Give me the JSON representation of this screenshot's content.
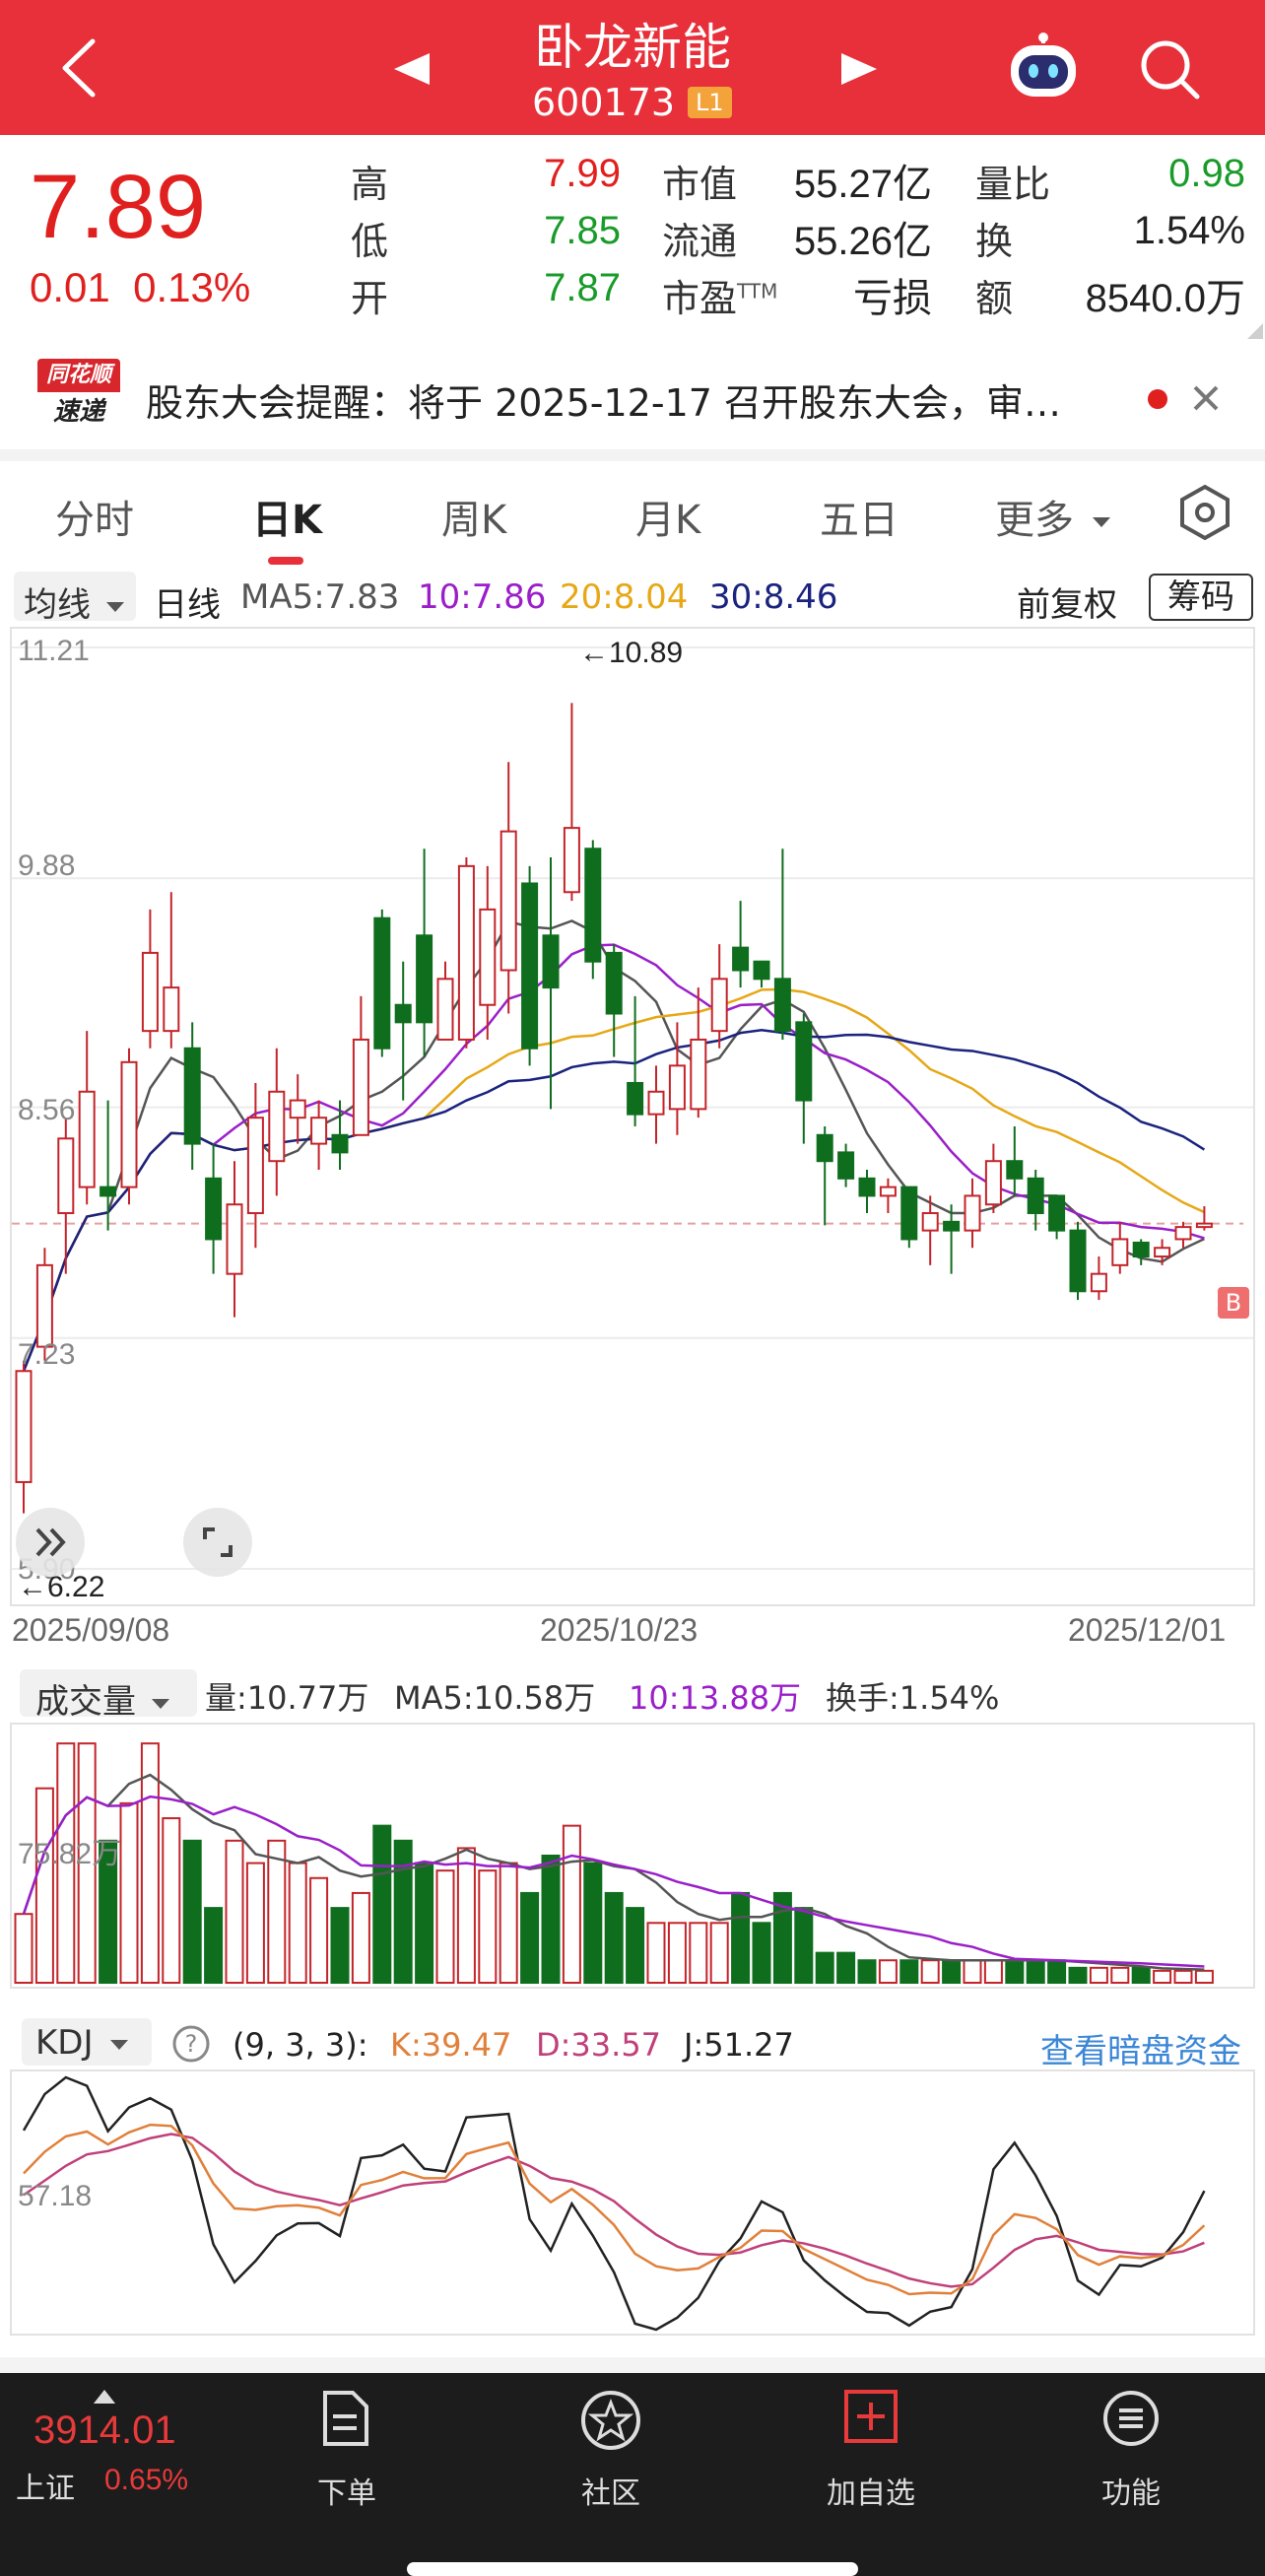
{
  "header": {
    "title": "卧龙新能",
    "code": "600173",
    "level_badge": "L1",
    "icons": [
      "back-icon",
      "prev-stock-icon",
      "next-stock-icon",
      "robot-assistant-icon",
      "search-icon"
    ]
  },
  "quote": {
    "price": "7.89",
    "change": "0.01",
    "change_pct": "0.13%",
    "fields": [
      {
        "label": "高",
        "value": "7.99",
        "color": "#e0201f"
      },
      {
        "label": "低",
        "value": "7.85",
        "color": "#199b2a"
      },
      {
        "label": "开",
        "value": "7.87",
        "color": "#199b2a"
      },
      {
        "label": "市值",
        "value": "55.27亿",
        "color": "#222222"
      },
      {
        "label": "流通",
        "value": "55.26亿",
        "color": "#222222"
      },
      {
        "label": "市盈",
        "label_sup": "TTM",
        "value": "亏损",
        "color": "#222222"
      },
      {
        "label": "量比",
        "value": "0.98",
        "color": "#199b2a"
      },
      {
        "label": "换",
        "value": "1.54%",
        "color": "#222222"
      },
      {
        "label": "额",
        "value": "8540.0万",
        "color": "#222222"
      }
    ]
  },
  "notice": {
    "logo_top": "同花顺",
    "logo_bottom": "速递",
    "text": "股东大会提醒：将于 2025-12-17 召开股东大会，审…"
  },
  "tabs": [
    {
      "label": "分时",
      "active": false
    },
    {
      "label": "日K",
      "active": true
    },
    {
      "label": "周K",
      "active": false
    },
    {
      "label": "月K",
      "active": false
    },
    {
      "label": "五日",
      "active": false
    },
    {
      "label": "更多",
      "active": false
    }
  ],
  "kline_panel": {
    "indicator_select": "均线",
    "period": "日线",
    "ma_legend": [
      {
        "text": "MA5:7.83",
        "color": "#555555"
      },
      {
        "text": "10:7.86",
        "color": "#9a1fc9"
      },
      {
        "text": "20:8.04",
        "color": "#e6a817"
      },
      {
        "text": "30:8.46",
        "color": "#1a237e"
      }
    ],
    "adjust": "前复权",
    "chips_button": "筹码",
    "y_labels": [
      "11.21",
      "9.88",
      "8.56",
      "7.23",
      "5.90"
    ],
    "high_marker": "←10.89",
    "low_marker": "←6.22",
    "dates": [
      "2025/09/08",
      "2025/10/23",
      "2025/12/01"
    ],
    "buy_marker": "B",
    "colors": {
      "up": "#c3242a",
      "down": "#0f6e1e",
      "ma5": "#555555",
      "ma10": "#9a1fc9",
      "ma20": "#e6a817",
      "ma30": "#1a237e"
    }
  },
  "volume_panel": {
    "select": "成交量",
    "vol": "量:10.77万",
    "ma5": "MA5:10.58万",
    "ma10": "10:13.88万",
    "turnover": "换手:1.54%",
    "y_label": "75.82万"
  },
  "kdj_panel": {
    "select": "KDJ",
    "params": "(9, 3, 3):",
    "k": "K:39.47",
    "d": "D:33.57",
    "j": "J:51.27",
    "link": "查看暗盘资金",
    "y_label": "57.18",
    "colors": {
      "k": "#e0803a",
      "d": "#c0407a",
      "j": "#222222"
    }
  },
  "bottom_bar": {
    "index_value": "3914.01",
    "index_name": "上证",
    "index_pct": "0.65%",
    "items": [
      {
        "label": "下单",
        "icon": "order-document-icon"
      },
      {
        "label": "社区",
        "icon": "community-star-icon"
      },
      {
        "label": "加自选",
        "icon": "add-watchlist-icon"
      },
      {
        "label": "功能",
        "icon": "menu-function-icon"
      }
    ]
  },
  "chart_data": {
    "type": "candlestick",
    "dates_shown": [
      "2025/09/08",
      "2025/10/23",
      "2025/12/01"
    ],
    "ylim": [
      5.9,
      11.21
    ],
    "y_ticks": [
      11.21,
      9.88,
      8.56,
      7.23,
      5.9
    ],
    "candles": [
      {
        "o": 6.4,
        "c": 7.04,
        "h": 7.1,
        "l": 6.22
      },
      {
        "o": 7.18,
        "c": 7.65,
        "h": 7.75,
        "l": 7.1
      },
      {
        "o": 7.95,
        "c": 8.38,
        "h": 8.5,
        "l": 7.6
      },
      {
        "o": 8.1,
        "c": 8.65,
        "h": 9.0,
        "l": 8.0
      },
      {
        "o": 8.1,
        "c": 8.05,
        "h": 8.6,
        "l": 7.85
      },
      {
        "o": 8.1,
        "c": 8.82,
        "h": 8.9,
        "l": 8.0
      },
      {
        "o": 9.0,
        "c": 9.45,
        "h": 9.7,
        "l": 8.9
      },
      {
        "o": 9.0,
        "c": 9.25,
        "h": 9.8,
        "l": 8.9
      },
      {
        "o": 8.9,
        "c": 8.35,
        "h": 9.05,
        "l": 8.2
      },
      {
        "o": 8.15,
        "c": 7.8,
        "h": 8.35,
        "l": 7.6
      },
      {
        "o": 7.6,
        "c": 8.0,
        "h": 8.25,
        "l": 7.35
      },
      {
        "o": 7.95,
        "c": 8.5,
        "h": 8.7,
        "l": 7.75
      },
      {
        "o": 8.25,
        "c": 8.65,
        "h": 8.9,
        "l": 8.05
      },
      {
        "o": 8.5,
        "c": 8.6,
        "h": 8.75,
        "l": 8.35
      },
      {
        "o": 8.35,
        "c": 8.5,
        "h": 8.6,
        "l": 8.2
      },
      {
        "o": 8.4,
        "c": 8.3,
        "h": 8.6,
        "l": 8.2
      },
      {
        "o": 8.4,
        "c": 8.95,
        "h": 9.2,
        "l": 8.4
      },
      {
        "o": 9.65,
        "c": 8.9,
        "h": 9.7,
        "l": 8.85
      },
      {
        "o": 9.15,
        "c": 9.05,
        "h": 9.4,
        "l": 8.6
      },
      {
        "o": 9.55,
        "c": 9.05,
        "h": 10.05,
        "l": 8.85
      },
      {
        "o": 8.95,
        "c": 9.3,
        "h": 9.4,
        "l": 8.95
      },
      {
        "o": 8.95,
        "c": 9.95,
        "h": 10.0,
        "l": 8.9
      },
      {
        "o": 9.15,
        "c": 9.7,
        "h": 9.95,
        "l": 8.95
      },
      {
        "o": 9.35,
        "c": 10.15,
        "h": 10.55,
        "l": 9.1
      },
      {
        "o": 9.85,
        "c": 8.9,
        "h": 9.95,
        "l": 8.8
      },
      {
        "o": 9.55,
        "c": 9.25,
        "h": 10.0,
        "l": 8.55
      },
      {
        "o": 9.8,
        "c": 10.17,
        "h": 10.89,
        "l": 9.75
      },
      {
        "o": 10.05,
        "c": 9.4,
        "h": 10.1,
        "l": 9.3
      },
      {
        "o": 9.45,
        "c": 9.1,
        "h": 9.5,
        "l": 8.85
      },
      {
        "o": 8.7,
        "c": 8.52,
        "h": 9.2,
        "l": 8.45
      },
      {
        "o": 8.52,
        "c": 8.65,
        "h": 8.8,
        "l": 8.35
      },
      {
        "o": 8.55,
        "c": 8.8,
        "h": 9.05,
        "l": 8.4
      },
      {
        "o": 8.55,
        "c": 8.95,
        "h": 9.25,
        "l": 8.5
      },
      {
        "o": 9.0,
        "c": 9.3,
        "h": 9.5,
        "l": 8.9
      },
      {
        "o": 9.48,
        "c": 9.35,
        "h": 9.75,
        "l": 9.25
      },
      {
        "o": 9.4,
        "c": 9.3,
        "h": 9.4,
        "l": 9.25
      },
      {
        "o": 9.3,
        "c": 9.0,
        "h": 10.05,
        "l": 8.95
      },
      {
        "o": 9.05,
        "c": 8.6,
        "h": 9.1,
        "l": 8.35
      },
      {
        "o": 8.4,
        "c": 8.25,
        "h": 8.45,
        "l": 7.88
      },
      {
        "o": 8.3,
        "c": 8.15,
        "h": 8.35,
        "l": 8.1
      },
      {
        "o": 8.15,
        "c": 8.05,
        "h": 8.2,
        "l": 7.95
      },
      {
        "o": 8.05,
        "c": 8.1,
        "h": 8.15,
        "l": 7.95
      },
      {
        "o": 8.1,
        "c": 7.8,
        "h": 8.1,
        "l": 7.75
      },
      {
        "o": 7.85,
        "c": 7.95,
        "h": 8.05,
        "l": 7.65
      },
      {
        "o": 7.9,
        "c": 7.85,
        "h": 8.0,
        "l": 7.6
      },
      {
        "o": 7.85,
        "c": 8.05,
        "h": 8.15,
        "l": 7.75
      },
      {
        "o": 8.0,
        "c": 8.25,
        "h": 8.35,
        "l": 7.95
      },
      {
        "o": 8.25,
        "c": 8.15,
        "h": 8.45,
        "l": 8.05
      },
      {
        "o": 8.15,
        "c": 7.95,
        "h": 8.2,
        "l": 7.85
      },
      {
        "o": 8.05,
        "c": 7.85,
        "h": 8.05,
        "l": 7.8
      },
      {
        "o": 7.85,
        "c": 7.5,
        "h": 7.9,
        "l": 7.45
      },
      {
        "o": 7.5,
        "c": 7.6,
        "h": 7.7,
        "l": 7.45
      },
      {
        "o": 7.65,
        "c": 7.8,
        "h": 7.9,
        "l": 7.6
      },
      {
        "o": 7.78,
        "c": 7.7,
        "h": 7.8,
        "l": 7.65
      },
      {
        "o": 7.7,
        "c": 7.75,
        "h": 7.8,
        "l": 7.65
      },
      {
        "o": 7.8,
        "c": 7.87,
        "h": 7.9,
        "l": 7.75
      },
      {
        "o": 7.87,
        "c": 7.89,
        "h": 7.99,
        "l": 7.85
      }
    ],
    "volume": [
      46,
      130,
      160,
      160,
      95,
      120,
      160,
      110,
      95,
      50,
      95,
      80,
      95,
      80,
      70,
      50,
      60,
      105,
      95,
      80,
      75,
      90,
      75,
      80,
      60,
      85,
      105,
      80,
      60,
      50,
      40,
      40,
      40,
      40,
      60,
      40,
      60,
      50,
      20,
      20,
      15,
      15,
      15,
      15,
      15,
      15,
      15,
      15,
      15,
      15,
      10,
      10,
      10,
      10,
      8,
      8,
      8
    ]
  }
}
